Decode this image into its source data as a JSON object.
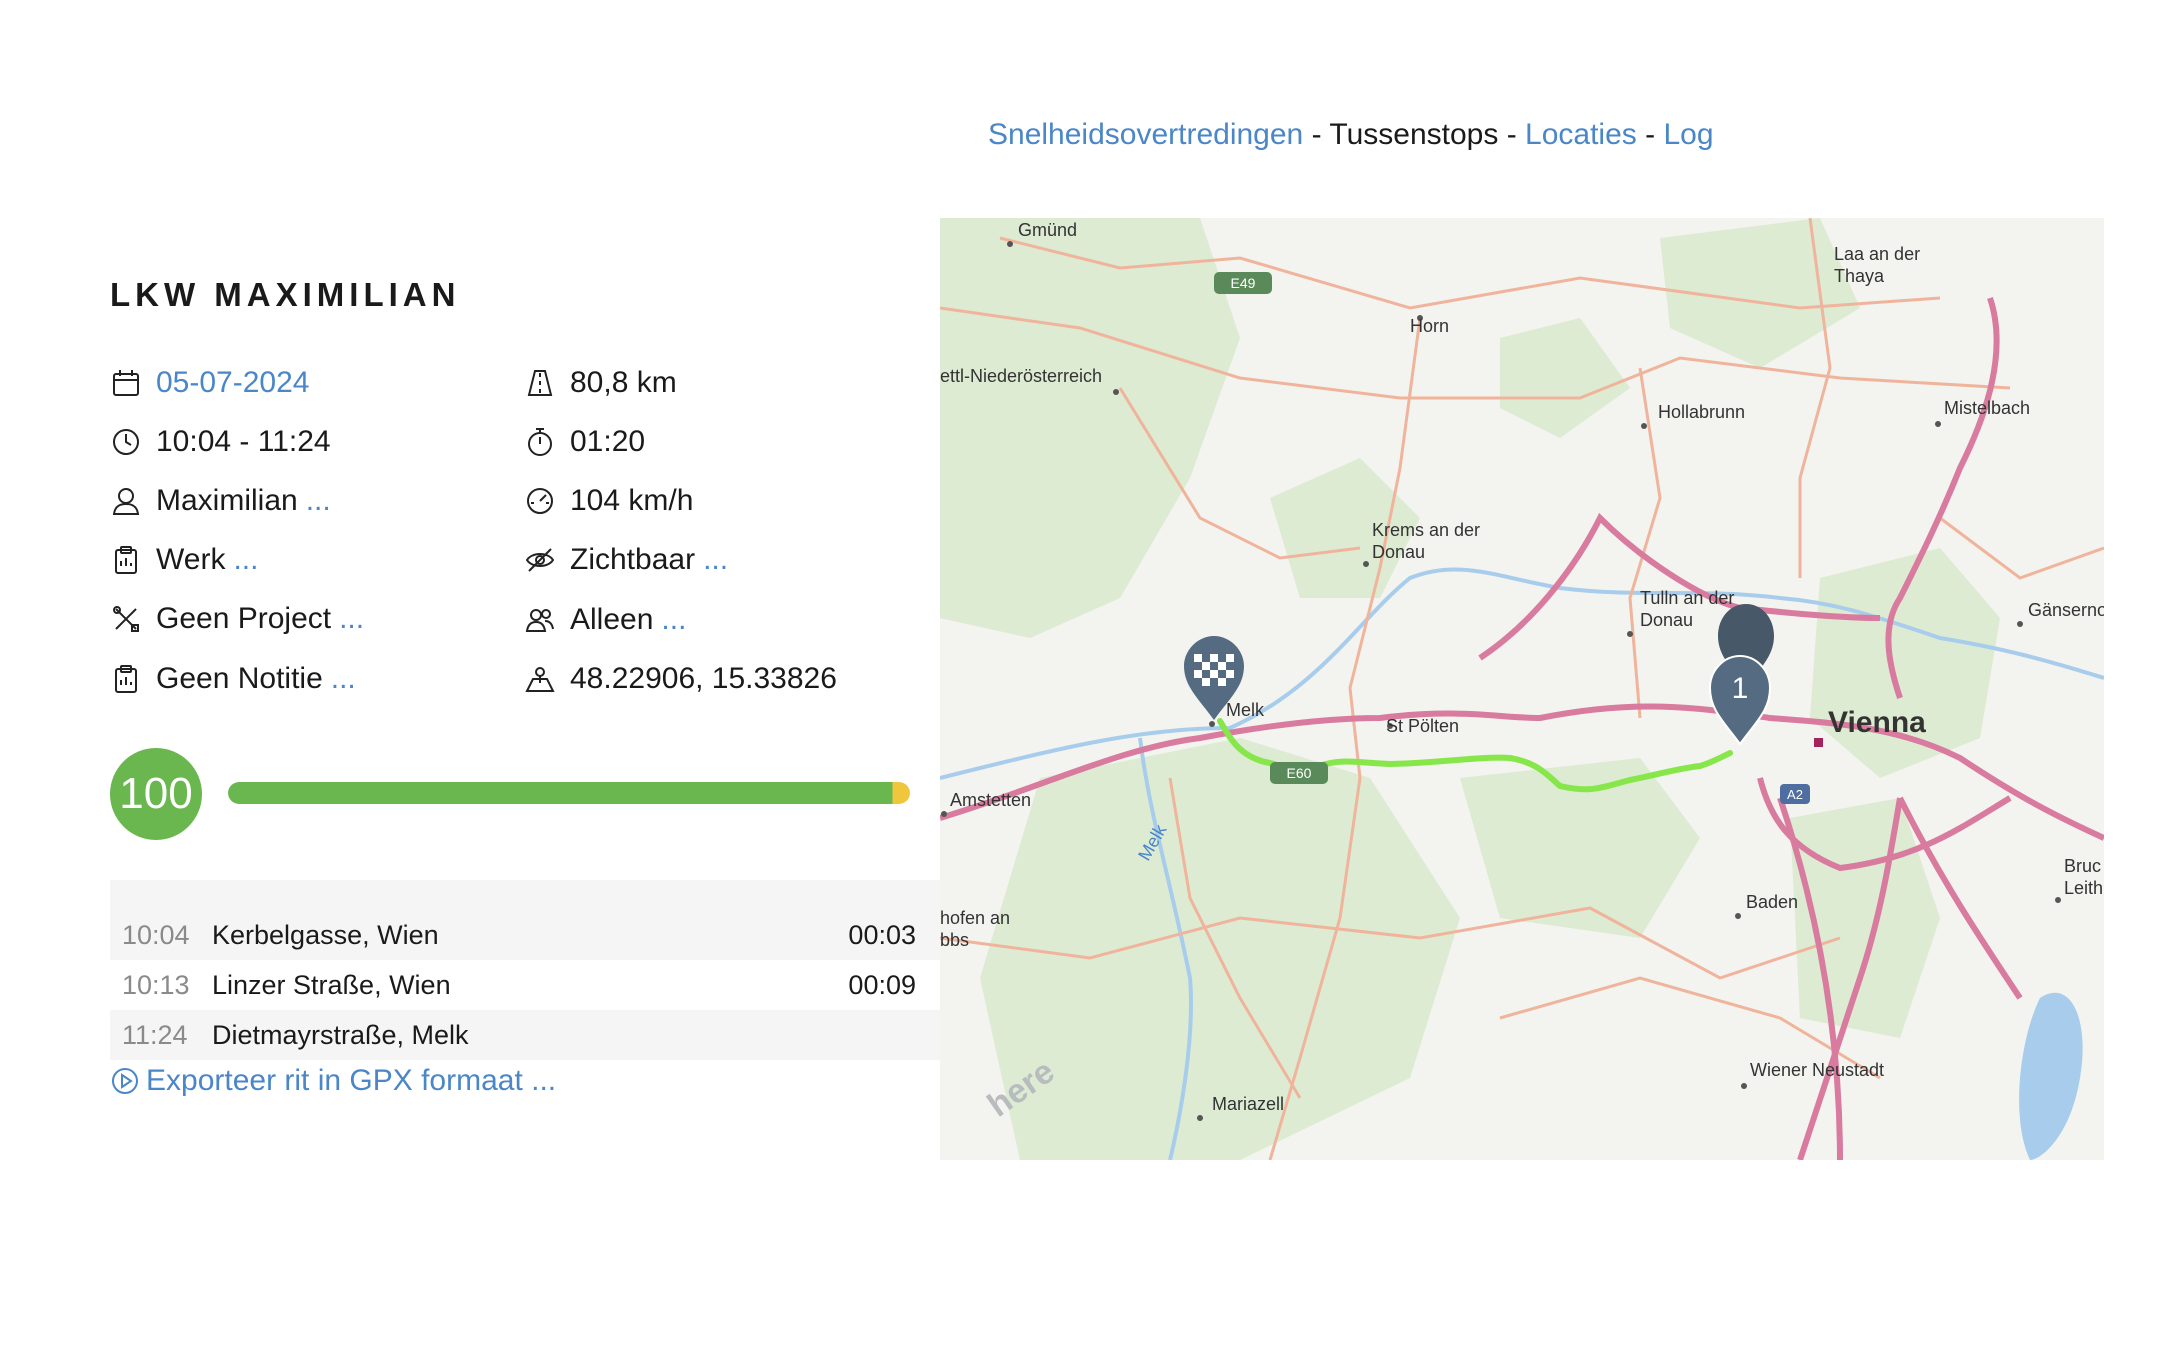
{
  "nav": {
    "speeding": "Snelheidsovertredingen",
    "sep1": "-",
    "stops": "Tussenstops",
    "sep2": "-",
    "locations": "Locaties",
    "sep3": "-",
    "log": "Log"
  },
  "vehicle": {
    "title": "LKW MAXIMILIAN"
  },
  "details": {
    "date": "05-07-2024",
    "time_range": "10:04 - 11:24",
    "driver": "Maximilian",
    "driver_more": "...",
    "category": "Werk",
    "category_more": "...",
    "project": "Geen Project",
    "project_more": "...",
    "note": "Geen Notitie",
    "note_more": "...",
    "distance": "80,8 km",
    "duration": "01:20",
    "max_speed": "104 km/h",
    "visibility": "Zichtbaar",
    "visibility_more": "...",
    "companions": "Alleen",
    "companions_more": "...",
    "coordinates": "48.22906, 15.33826"
  },
  "score": {
    "value": "100",
    "fraction": 1.0
  },
  "stops": [
    {
      "time": "10:04",
      "address": "Kerbelgasse, Wien",
      "duration": "00:03"
    },
    {
      "time": "10:13",
      "address": "Linzer Straße, Wien",
      "duration": "00:09"
    },
    {
      "time": "11:24",
      "address": "Dietmayrstraße, Melk",
      "duration": ""
    }
  ],
  "export": {
    "label": "Exporteer rit in GPX formaat ..."
  },
  "map": {
    "labels": {
      "gmund": "Gmünd",
      "laa1": "Laa an der",
      "laa2": "Thaya",
      "horn": "Horn",
      "zwettl": "ettl-Niederösterreich",
      "hollabrunn": "Hollabrunn",
      "mistelbach": "Mistelbach",
      "krems1": "Krems an der",
      "krems2": "Donau",
      "tulln1": "Tulln an der",
      "tulln2": "Donau",
      "ganserndorf": "Gänserno",
      "melk": "Melk",
      "stpolten": "St Pölten",
      "vienna": "Vienna",
      "amstetten": "Amstetten",
      "melk_river": "Melk",
      "bruck1": "Bruc",
      "bruck2": "Leith",
      "hofen1": "hofen an",
      "hofen2": "bbs",
      "baden": "Baden",
      "wiener_neustadt": "Wiener Neustadt",
      "mariazell": "Mariazell",
      "e49": "E49",
      "e60": "E60",
      "a2": "A2",
      "marker_number": "1",
      "watermark": "here"
    },
    "colors": {
      "route": "#86e64a",
      "highway": "#d97a9f",
      "road": "#f0b49c",
      "forest": "#d9ead0",
      "water": "#a8cdec",
      "marker": "#546b82"
    }
  }
}
